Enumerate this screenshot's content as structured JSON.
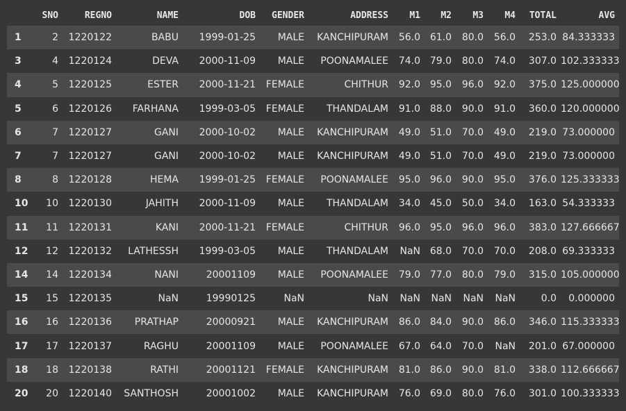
{
  "columns": [
    "",
    "SNO",
    "REGNO",
    "NAME",
    "DOB",
    "GENDER",
    "ADDRESS",
    "M1",
    "M2",
    "M3",
    "M4",
    "TOTAL",
    "AVG"
  ],
  "rows": [
    [
      "1",
      "2",
      "1220122",
      "BABU",
      "1999-01-25",
      "MALE",
      "KANCHIPURAM",
      "56.0",
      "61.0",
      "80.0",
      "56.0",
      "253.0",
      "84.333333"
    ],
    [
      "3",
      "4",
      "1220124",
      "DEVA",
      "2000-11-09",
      "MALE",
      "POONAMALEE",
      "74.0",
      "79.0",
      "80.0",
      "74.0",
      "307.0",
      "102.333333"
    ],
    [
      "4",
      "5",
      "1220125",
      "ESTER",
      "2000-11-21",
      "FEMALE",
      "CHITHUR",
      "92.0",
      "95.0",
      "96.0",
      "92.0",
      "375.0",
      "125.000000"
    ],
    [
      "5",
      "6",
      "1220126",
      "FARHANA",
      "1999-03-05",
      "FEMALE",
      "THANDALAM",
      "91.0",
      "88.0",
      "90.0",
      "91.0",
      "360.0",
      "120.000000"
    ],
    [
      "6",
      "7",
      "1220127",
      "GANI",
      "2000-10-02",
      "MALE",
      "KANCHIPURAM",
      "49.0",
      "51.0",
      "70.0",
      "49.0",
      "219.0",
      "73.000000"
    ],
    [
      "7",
      "7",
      "1220127",
      "GANI",
      "2000-10-02",
      "MALE",
      "KANCHIPURAM",
      "49.0",
      "51.0",
      "70.0",
      "49.0",
      "219.0",
      "73.000000"
    ],
    [
      "8",
      "8",
      "1220128",
      "HEMA",
      "1999-01-25",
      "FEMALE",
      "POONAMALEE",
      "95.0",
      "96.0",
      "90.0",
      "95.0",
      "376.0",
      "125.333333"
    ],
    [
      "10",
      "10",
      "1220130",
      "JAHITH",
      "2000-11-09",
      "MALE",
      "THANDALAM",
      "34.0",
      "45.0",
      "50.0",
      "34.0",
      "163.0",
      "54.333333"
    ],
    [
      "11",
      "11",
      "1220131",
      "KANI",
      "2000-11-21",
      "FEMALE",
      "CHITHUR",
      "96.0",
      "95.0",
      "96.0",
      "96.0",
      "383.0",
      "127.666667"
    ],
    [
      "12",
      "12",
      "1220132",
      "LATHESSH",
      "1999-03-05",
      "MALE",
      "THANDALAM",
      "NaN",
      "68.0",
      "70.0",
      "70.0",
      "208.0",
      "69.333333"
    ],
    [
      "14",
      "14",
      "1220134",
      "NANI",
      "20001109",
      "MALE",
      "POONAMALEE",
      "79.0",
      "77.0",
      "80.0",
      "79.0",
      "315.0",
      "105.000000"
    ],
    [
      "15",
      "15",
      "1220135",
      "NaN",
      "19990125",
      "NaN",
      "NaN",
      "NaN",
      "NaN",
      "NaN",
      "NaN",
      "0.0",
      "0.000000"
    ],
    [
      "16",
      "16",
      "1220136",
      "PRATHAP",
      "20000921",
      "MALE",
      "KANCHIPURAM",
      "86.0",
      "84.0",
      "90.0",
      "86.0",
      "346.0",
      "115.333333"
    ],
    [
      "17",
      "17",
      "1220137",
      "RAGHU",
      "20001109",
      "MALE",
      "POONAMALEE",
      "67.0",
      "64.0",
      "70.0",
      "NaN",
      "201.0",
      "67.000000"
    ],
    [
      "18",
      "18",
      "1220138",
      "RATHI",
      "20001121",
      "FEMALE",
      "KANCHIPURAM",
      "81.0",
      "86.0",
      "90.0",
      "81.0",
      "338.0",
      "112.666667"
    ],
    [
      "20",
      "20",
      "1220140",
      "SANTHOSH",
      "20001002",
      "MALE",
      "KANCHIPURAM",
      "76.0",
      "69.0",
      "80.0",
      "76.0",
      "301.0",
      "100.333333"
    ]
  ],
  "colors": {
    "background": "#373737",
    "row_odd": "#4a4a4a",
    "row_even": "#373737",
    "row_hover": "#555555",
    "text": "#e6e6e6"
  }
}
